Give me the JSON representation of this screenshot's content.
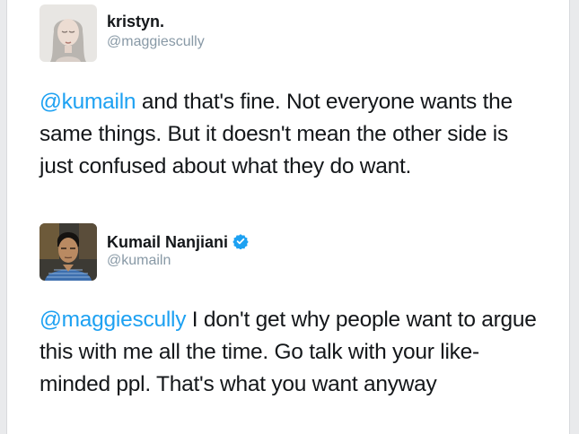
{
  "tweets": [
    {
      "display_name": "kristyn.",
      "handle": "@maggiescully",
      "verified": false,
      "avatar_icon": "grayscale-portrait-avatar",
      "mention": "@kumailn",
      "body": " and that's fine. Not everyone wants the same things. But it doesn't mean the other side is just confused about what they do want."
    },
    {
      "display_name": "Kumail Nanjiani",
      "handle": "@kumailn",
      "verified": true,
      "avatar_icon": "man-portrait-avatar",
      "mention": "@maggiescully",
      "body": " I don't get why people want to argue this with me all the time. Go talk with your like-minded ppl. That's what you want anyway"
    }
  ],
  "colors": {
    "link": "#1da1f2",
    "text": "#14171a",
    "handle": "#8899a6",
    "verified_badge": "#1da1f2"
  }
}
